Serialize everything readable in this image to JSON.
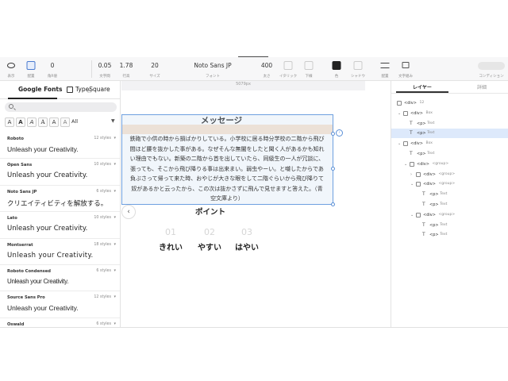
{
  "toolbar": {
    "items": [
      {
        "value": "",
        "label": "表示"
      },
      {
        "value": "",
        "label": "配置"
      },
      {
        "value": "0",
        "label": "角R値"
      },
      {
        "value": "0.05",
        "label": "文字間"
      },
      {
        "value": "1.78",
        "label": "行高"
      },
      {
        "value": "20",
        "label": "サイズ"
      },
      {
        "value": "Noto Sans JP",
        "label": "フォント"
      },
      {
        "value": "400",
        "label": "太さ"
      },
      {
        "value": "",
        "label": "イタリック"
      },
      {
        "value": "",
        "label": "下線"
      },
      {
        "value": "",
        "label": "色"
      },
      {
        "value": "",
        "label": "シャドウ"
      },
      {
        "value": "",
        "label": "配置"
      },
      {
        "value": "",
        "label": "文字組み"
      },
      {
        "value": "",
        "label": "コンディション"
      }
    ],
    "color_swatch": "#222222"
  },
  "font_panel": {
    "tab_google": "Google Fonts",
    "tab_typesquare": "TypeSquare",
    "search_placeholder": "",
    "style_buttons": [
      "A",
      "A",
      "A",
      "A",
      "A",
      "A"
    ],
    "style_filter": "All",
    "fonts": [
      {
        "name": "Roboto",
        "styles": "12 styles",
        "sample": "Unleash your Creativity."
      },
      {
        "name": "Open Sans",
        "styles": "10 styles",
        "sample": "Unleash your Creativity."
      },
      {
        "name": "Noto Sans JP",
        "styles": "6 styles",
        "sample": "クリエイティビティを解放する。"
      },
      {
        "name": "Lato",
        "styles": "10 styles",
        "sample": "Unleash your Creativity."
      },
      {
        "name": "Montserrat",
        "styles": "18 styles",
        "sample": "Unleash your Creativity."
      },
      {
        "name": "Roboto Condensed",
        "styles": "6 styles",
        "sample": "Unleash your Creativity."
      },
      {
        "name": "Source Sans Pro",
        "styles": "12 styles",
        "sample": "Unleash your Creativity."
      },
      {
        "name": "Oswald",
        "styles": "6 styles",
        "sample": ""
      }
    ]
  },
  "canvas": {
    "ruler_label": "5079px",
    "message_title": "メッセージ",
    "paragraph_lines": [
      "鉄砲で小供の時から損ばかりしている。小学校に居る時分学校の二階から飛び",
      "間ほど腰を抜かした事がある。なぜそんな無闇をしたと聞く人があるかも知れ",
      "い理由でもない。新築の二階から首を出していたら、同級生の一人が冗談に、",
      "張っても、そこから飛び降りる事は出来まい。弱虫やーい。と囃したからであ",
      "負ぶさって帰って来た時、おやじが大きな眼をして二階ぐらいから飛び降りて",
      "奴があるかと云ったから、この次は抜かさずに飛んで見せますと答えた。（青",
      "空文庫より）"
    ],
    "point_title": "ポイント",
    "features": [
      {
        "num": "01",
        "label": "きれい"
      },
      {
        "num": "02",
        "label": "やすい"
      },
      {
        "num": "03",
        "label": "はやい"
      }
    ],
    "nav_left": "‹",
    "nav_right": "›"
  },
  "layer_panel": {
    "tab_layers": "レイヤー",
    "tab_detail": "詳細",
    "layers": [
      {
        "tag": "<div>",
        "sub": "12",
        "indent": 0,
        "chevron": "",
        "selected": false,
        "text_icon": false
      },
      {
        "tag": "<div>",
        "sub": "Box",
        "indent": 1,
        "chevron": "⌄",
        "selected": false,
        "text_icon": false
      },
      {
        "tag": "<p>",
        "sub": "Text",
        "indent": 2,
        "chevron": "",
        "selected": false,
        "text_icon": true
      },
      {
        "tag": "<p>",
        "sub": "Text",
        "indent": 2,
        "chevron": "",
        "selected": true,
        "text_icon": true
      },
      {
        "tag": "<div>",
        "sub": "Box",
        "indent": 1,
        "chevron": "⌄",
        "selected": false,
        "text_icon": false
      },
      {
        "tag": "<p>",
        "sub": "Text",
        "indent": 2,
        "chevron": "",
        "selected": false,
        "text_icon": true
      },
      {
        "tag": "<div>",
        "sub": "<group>",
        "indent": 2,
        "chevron": "⌄",
        "selected": false,
        "text_icon": false
      },
      {
        "tag": "<div>",
        "sub": "<group>",
        "indent": 3,
        "chevron": "›",
        "selected": false,
        "text_icon": false
      },
      {
        "tag": "<div>",
        "sub": "<group>",
        "indent": 3,
        "chevron": "⌄",
        "selected": false,
        "text_icon": false
      },
      {
        "tag": "<p>",
        "sub": "Text",
        "indent": 4,
        "chevron": "",
        "selected": false,
        "text_icon": true
      },
      {
        "tag": "<p>",
        "sub": "Text",
        "indent": 4,
        "chevron": "",
        "selected": false,
        "text_icon": true
      },
      {
        "tag": "<div>",
        "sub": "<group>",
        "indent": 3,
        "chevron": "⌄",
        "selected": false,
        "text_icon": false
      },
      {
        "tag": "<p>",
        "sub": "Text",
        "indent": 4,
        "chevron": "",
        "selected": false,
        "text_icon": true
      },
      {
        "tag": "<p>",
        "sub": "Text",
        "indent": 4,
        "chevron": "",
        "selected": false,
        "text_icon": true
      }
    ]
  },
  "colors": {
    "accent": "#6ea0e0",
    "selection": "#dde9fb",
    "peach_band": "#f8e3cf"
  }
}
